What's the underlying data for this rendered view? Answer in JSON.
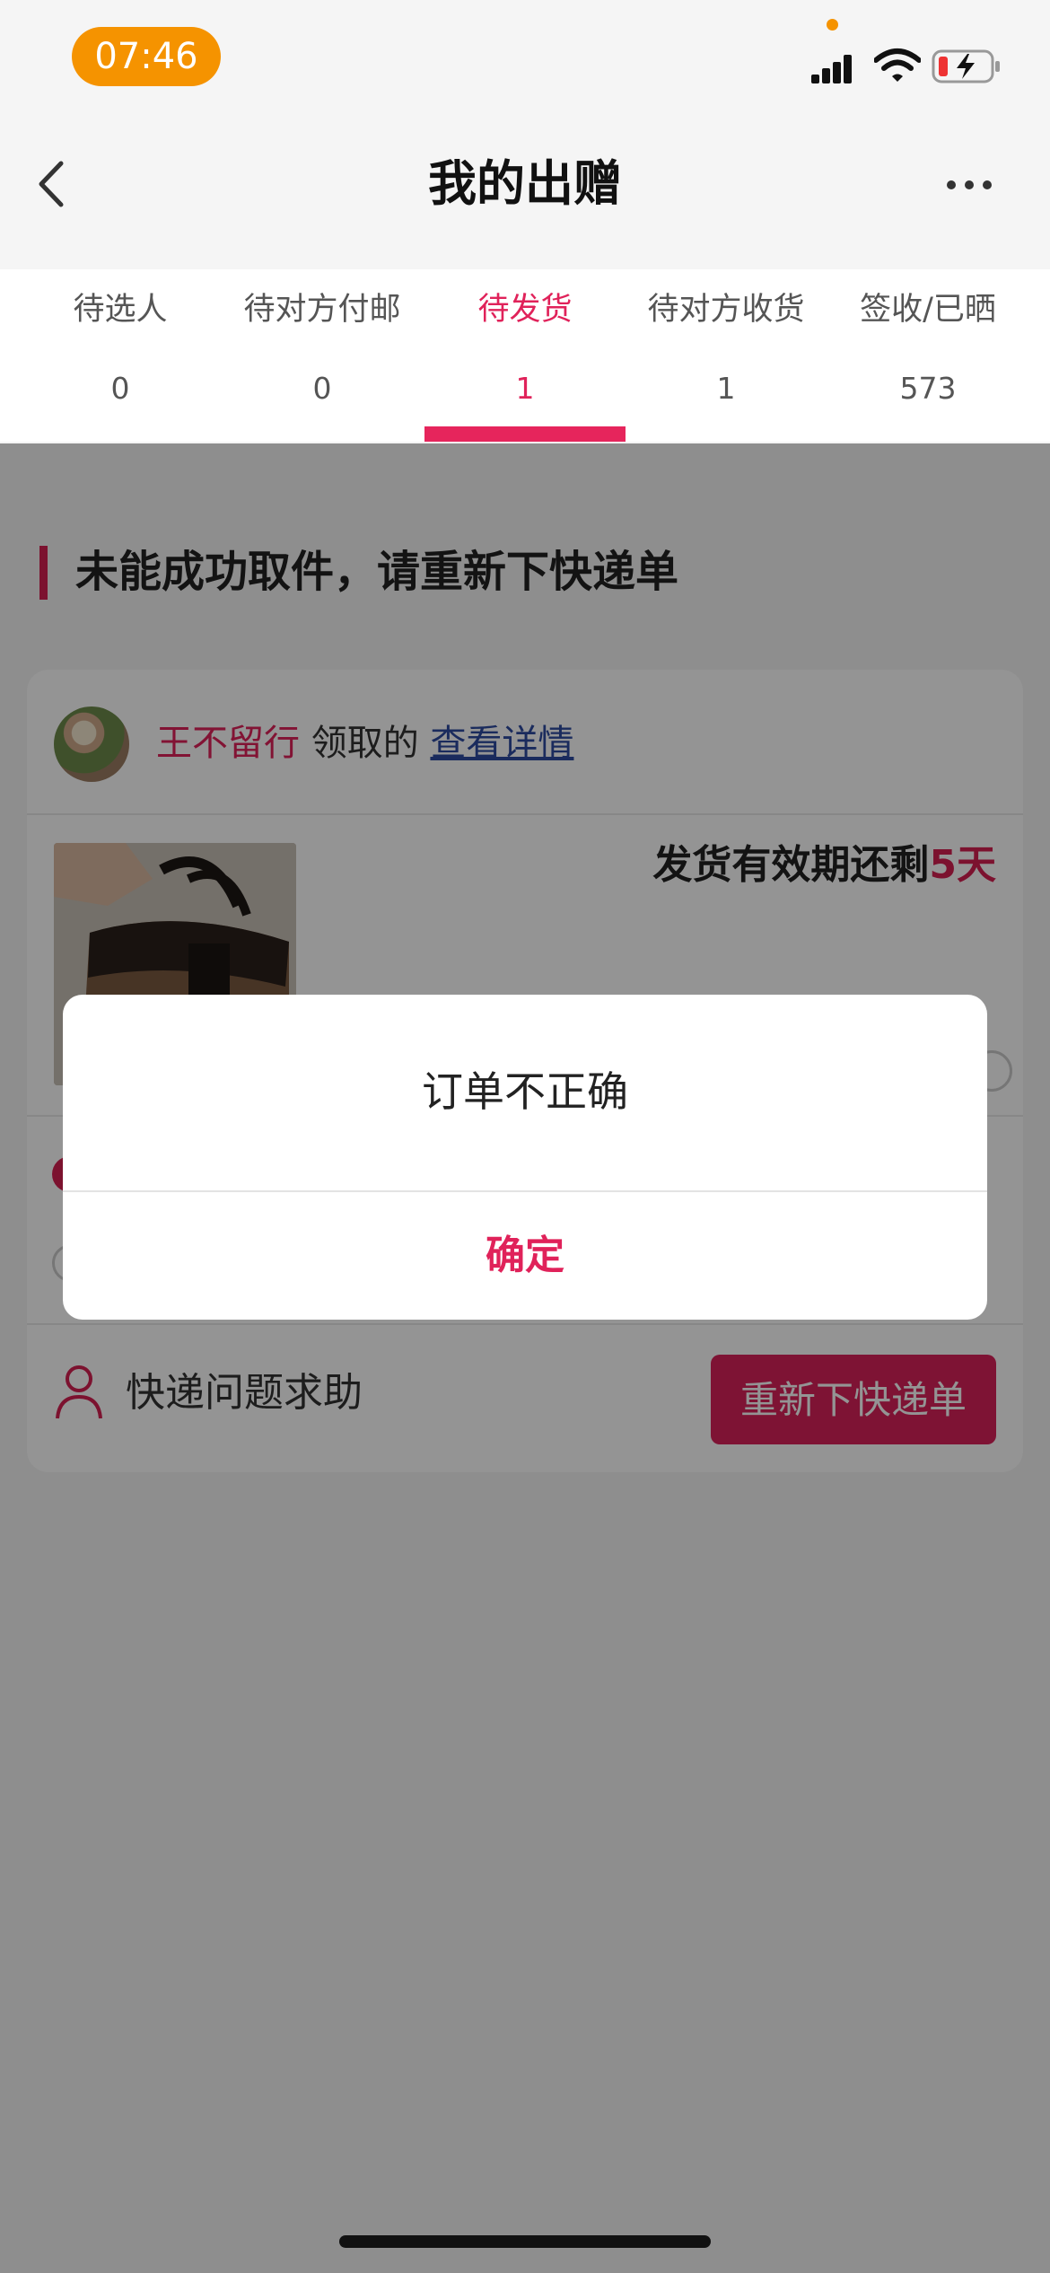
{
  "status_bar": {
    "time": "07:46"
  },
  "header": {
    "title": "我的出赠"
  },
  "tabs": [
    {
      "label": "待选人",
      "count": "0"
    },
    {
      "label": "待对方付邮",
      "count": "0"
    },
    {
      "label": "待发货",
      "count": "1",
      "active": true
    },
    {
      "label": "待对方收货",
      "count": "1"
    },
    {
      "label": "签收/已晒",
      "count": "573"
    }
  ],
  "section": {
    "title": "未能成功取件，请重新下快递单"
  },
  "card": {
    "user_name": "王不留行",
    "claimed_text": " 领取的 ",
    "view_details": "查看详情",
    "expiry_prefix": "发货有效期还剩",
    "expiry_days": "5天",
    "help_text": "快递问题求助",
    "reorder_button": "重新下快递单"
  },
  "dialog": {
    "message": "订单不正确",
    "confirm": "确定"
  },
  "colors": {
    "accent": "#e0225a",
    "status_pill": "#f59300"
  }
}
